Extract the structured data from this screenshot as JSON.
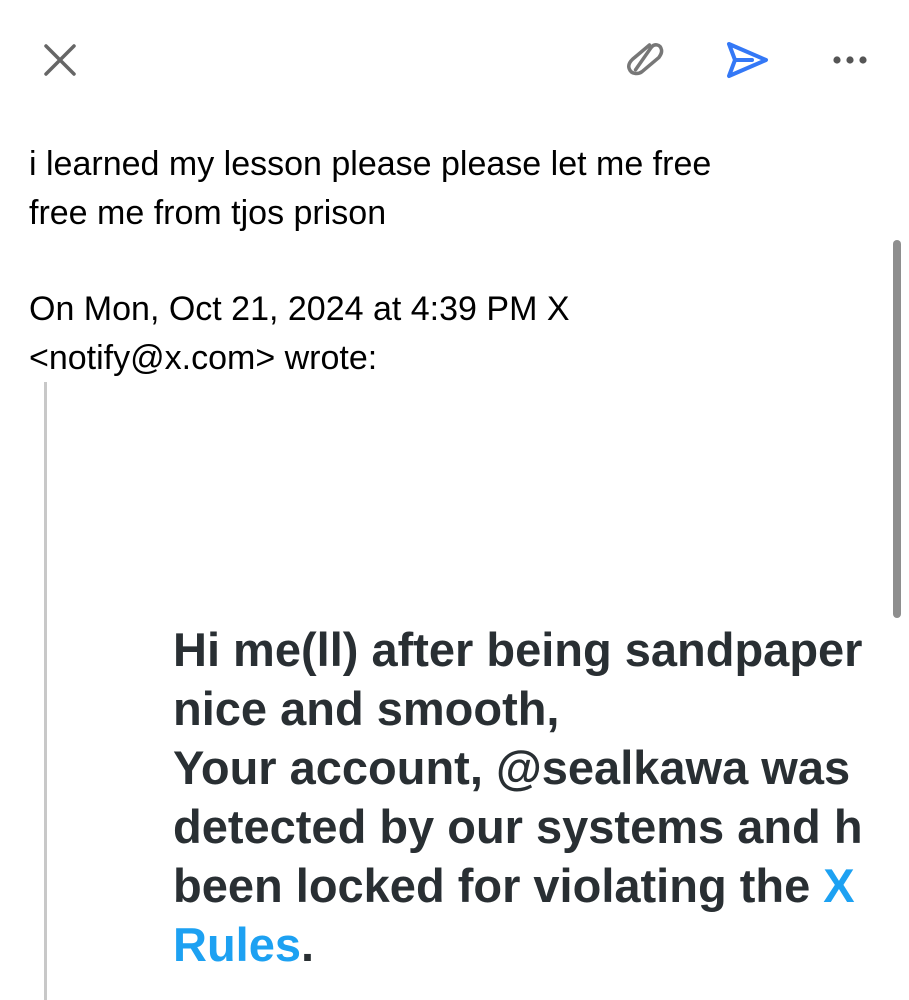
{
  "toolbar": {
    "close_icon": "close-icon",
    "attach_icon": "paperclip-icon",
    "send_icon": "send-icon",
    "more_icon": "more-icon",
    "accent_color": "#3478f6"
  },
  "reply": {
    "lines": [
      "i learned my lesson please please let me free",
      "free me from tjos prison"
    ]
  },
  "attribution": {
    "line1": "On Mon, Oct 21, 2024 at 4:39 PM X",
    "line2": "<notify@x.com> wrote:"
  },
  "quoted": {
    "line1": "Hi me(ll) after being sandpaper",
    "line2": "nice and smooth,",
    "line3": "Your account, @sealkawa was",
    "line4": "detected by our systems and h",
    "line5_prefix": "been locked for violating the ",
    "line5_link": "X",
    "line6_link": "Rules",
    "line6_suffix": ".",
    "link_color": "#1da1f2",
    "text_color": "#292f33"
  }
}
